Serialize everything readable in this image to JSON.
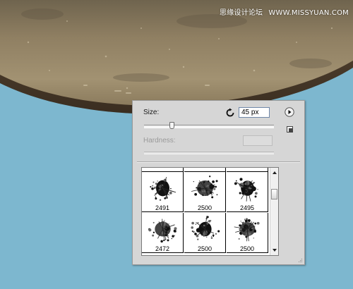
{
  "watermark": {
    "site_cn": "思缘设计论坛",
    "site_url": "WWW.MISSYUAN.COM"
  },
  "panel": {
    "size_label": "Size:",
    "size_value": "45 px",
    "size_slider_fraction": 0.22,
    "hardness_label": "Hardness:",
    "hardness_value": ""
  },
  "presets": {
    "partial_top_row": [
      "2491",
      "2500",
      "2495"
    ],
    "rows": [
      [
        "2491",
        "2500",
        "2495"
      ],
      [
        "2472",
        "2500",
        "2500"
      ]
    ],
    "scroll_fraction": 0.2
  },
  "icons": {
    "reset": "reset-icon",
    "menu": "flyout-menu-icon",
    "new_preset": "new-preset-icon",
    "scroll_up": "arrow-up-icon",
    "scroll_down": "arrow-down-icon",
    "resize": "resize-grip-icon"
  },
  "colors": {
    "sky": "#7db7cf",
    "stone": "#9b8b6c",
    "panel": "#d6d6d6",
    "input_border": "#6f87a8"
  }
}
